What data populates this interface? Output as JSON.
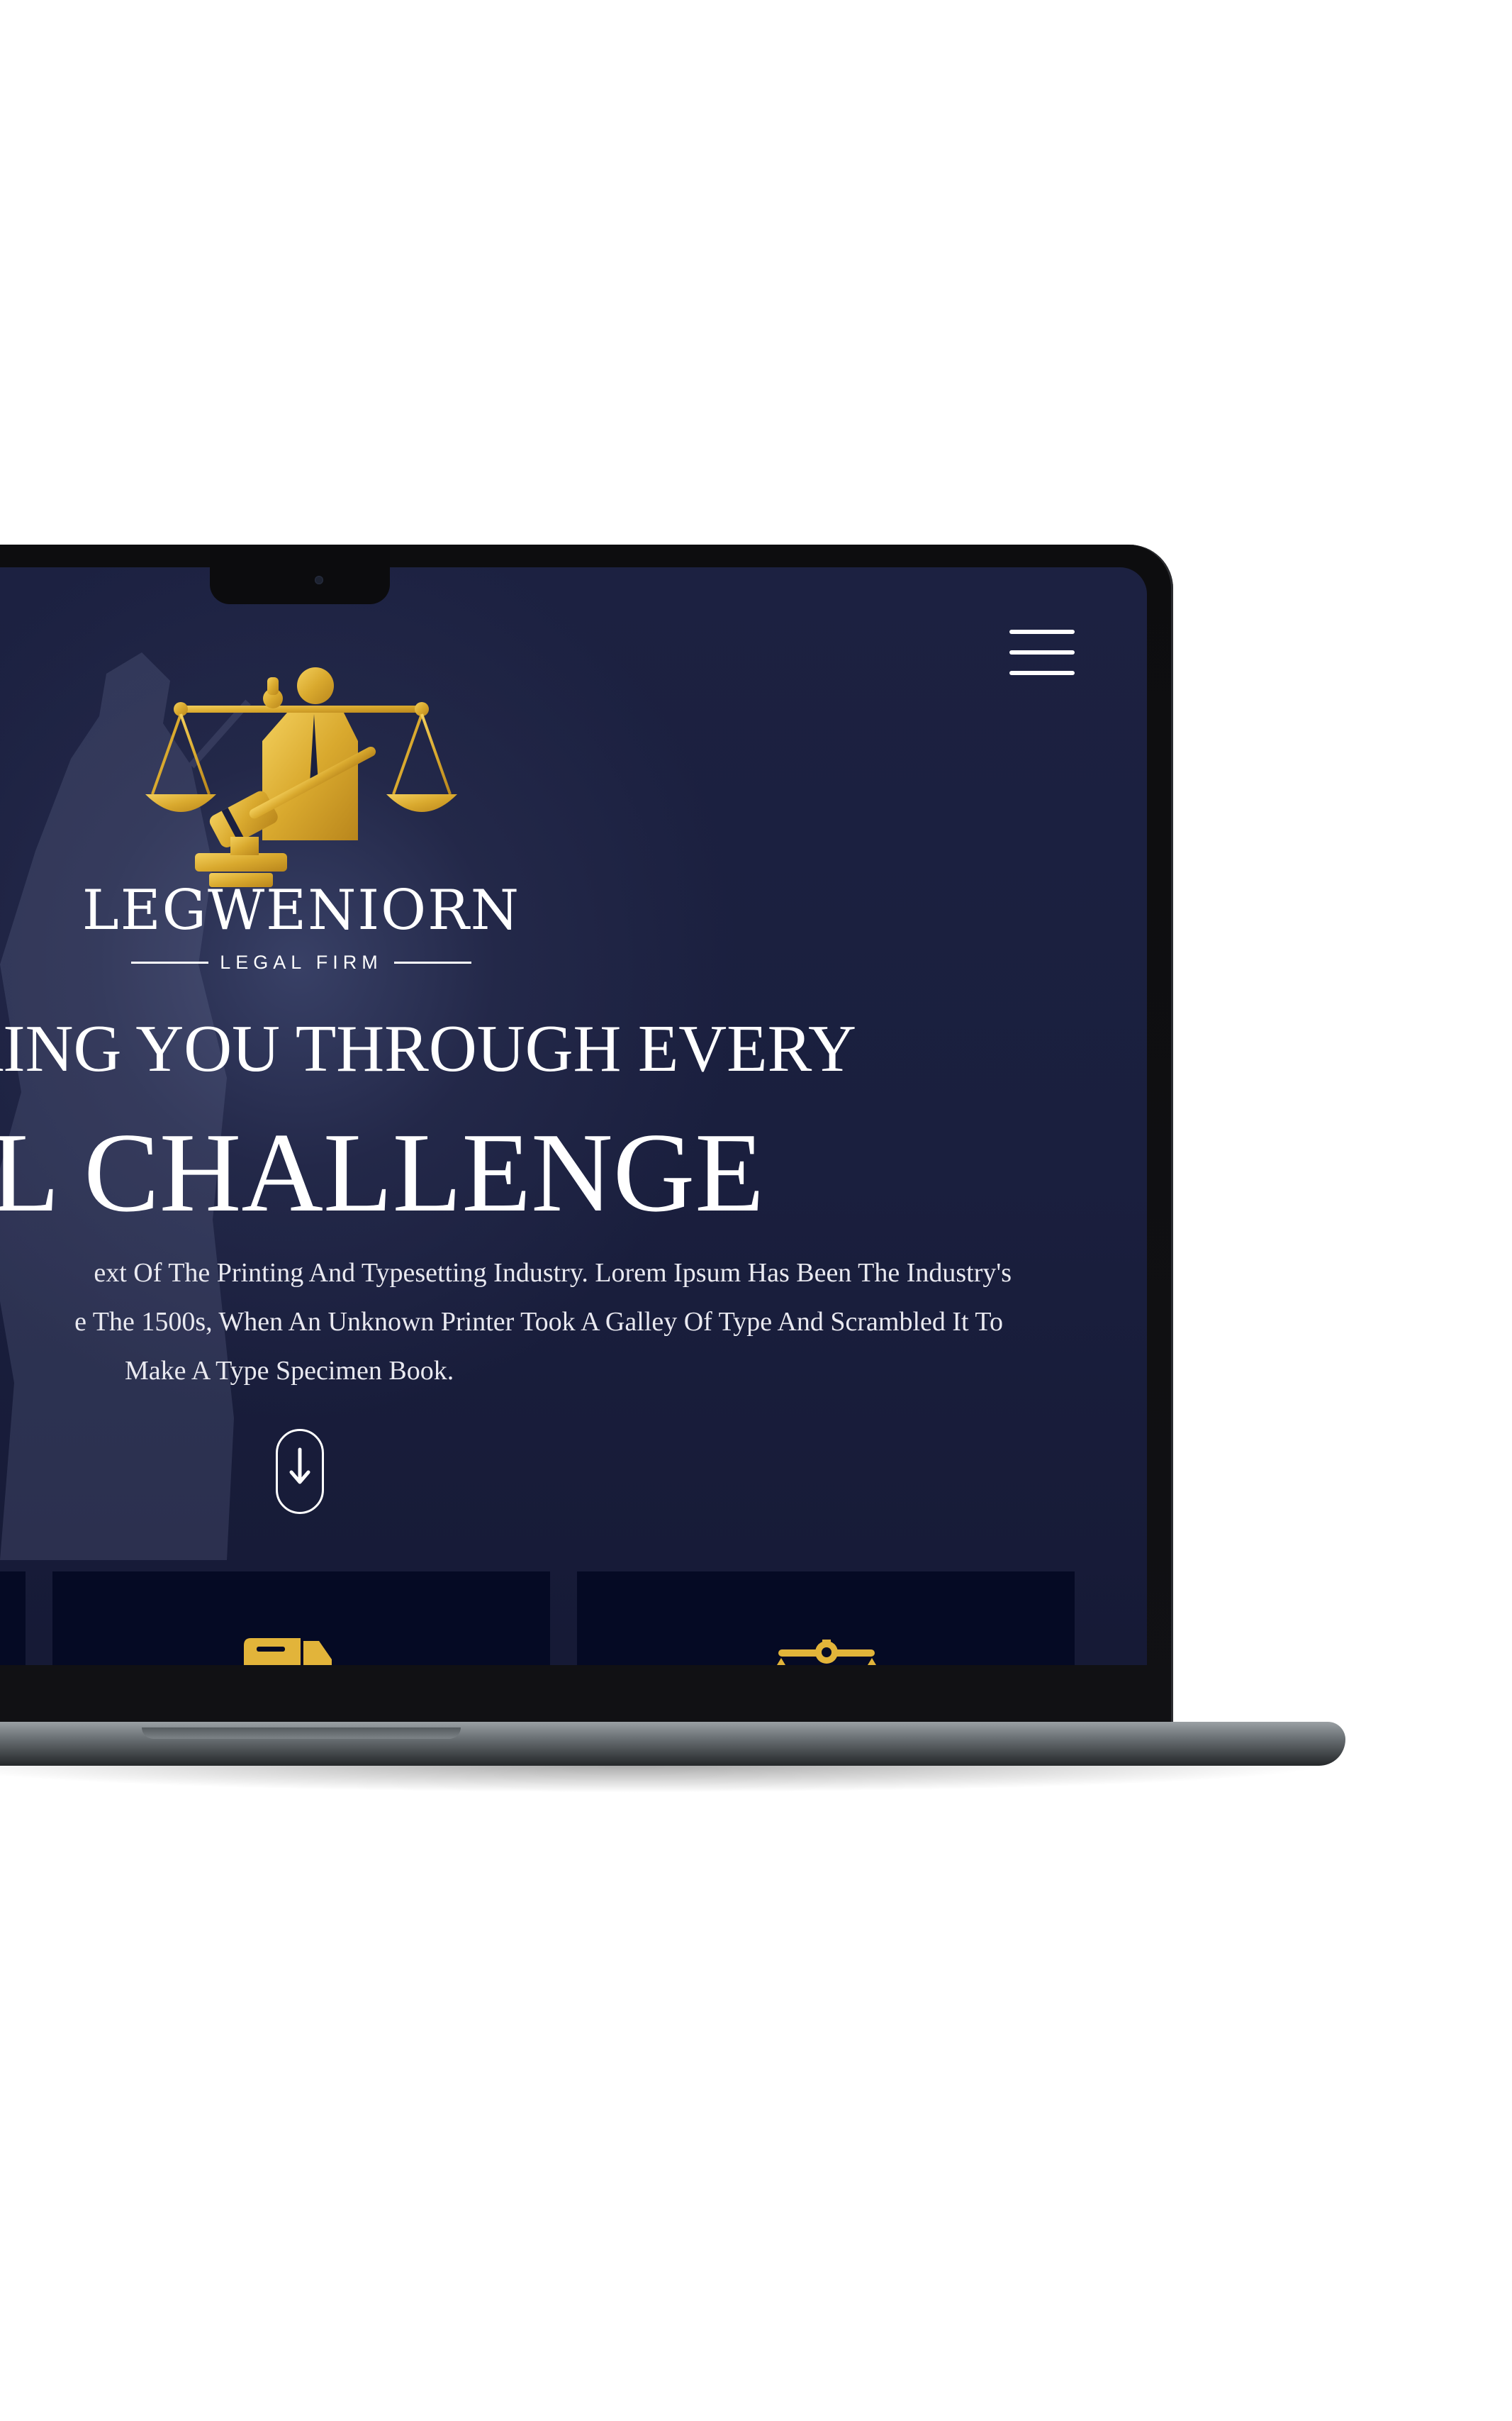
{
  "header": {
    "menu_icon": "hamburger-menu-icon"
  },
  "logo": {
    "emblem_icon": "scales-of-justice-gavel-lawyer-icon",
    "name": "LEGWENIORN",
    "subtitle": "LEGAL FIRM"
  },
  "hero": {
    "headline_line1": "ERING YOU THROUGH EVERY",
    "headline_line2": "GAL CHALLENGE",
    "description_lines": [
      "ext Of The Printing And Typesetting Industry. Lorem Ipsum Has Been The Industry's",
      "e The 1500s, When An Unknown Printer Took A Galley Of Type And Scrambled It To",
      "Make A Type Specimen Book."
    ],
    "scroll_icon": "arrow-down-icon"
  },
  "cards": [
    {
      "icon": ""
    },
    {
      "icon": "truck-icon"
    },
    {
      "icon": "scale-award-icon"
    }
  ],
  "colors": {
    "background": "#1a1f3e",
    "gold": "#e2b43a",
    "text": "#ffffff",
    "card": "#050a24"
  }
}
